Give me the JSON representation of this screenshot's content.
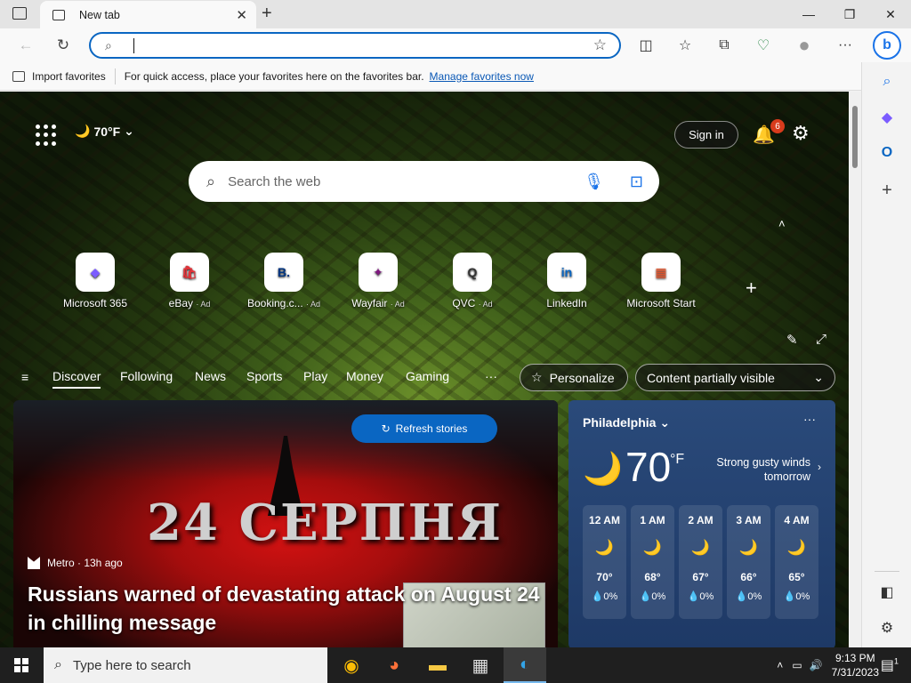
{
  "browser": {
    "tab_title": "New tab",
    "tab_close": "✕",
    "new_tab": "+",
    "window_min": "—",
    "window_max": "❐",
    "window_close": "✕"
  },
  "addressbar": {
    "value": "",
    "back": "←",
    "refresh": "↻",
    "favorite_star": "☆",
    "split_screen": "◫",
    "favorites": "☆",
    "collections": "⧉",
    "browser_essentials": "♡",
    "profile": "●",
    "more": "···",
    "bing": "b"
  },
  "favorites_bar": {
    "import_label": "Import favorites",
    "hint": "For quick access, place your favorites here on the favorites bar.",
    "manage_link": "Manage favorites now"
  },
  "sidebar": {
    "search": "⌕",
    "copilot": "◆",
    "outlook": "O",
    "add": "+",
    "layout": "◧",
    "settings": "⚙"
  },
  "page": {
    "weather_temp": "70°F",
    "moon": "🌙",
    "signin": "Sign in",
    "notification_count": "6",
    "search_placeholder": "Search the web",
    "search_icon": "⌕",
    "mic_icon": "🎙",
    "visual_search_icon": "⊡",
    "collapse_caret": "˄",
    "add_tile": "+",
    "tiles": [
      {
        "label": "Microsoft 365",
        "ad": "",
        "glyph": "◆",
        "color": "#7b5cff"
      },
      {
        "label": "eBay",
        "ad": "· Ad",
        "glyph": "🛍",
        "color": "#e53238"
      },
      {
        "label": "Booking.c...",
        "ad": "· Ad",
        "glyph": "B.",
        "color": "#003580"
      },
      {
        "label": "Wayfair",
        "ad": "· Ad",
        "glyph": "✦",
        "color": "#7f187f"
      },
      {
        "label": "QVC",
        "ad": "· Ad",
        "glyph": "Q",
        "color": "#333333"
      },
      {
        "label": "LinkedIn",
        "ad": "",
        "glyph": "in",
        "color": "#0a66c2"
      },
      {
        "label": "Microsoft Start",
        "ad": "",
        "glyph": "▦",
        "color": "#f25022"
      }
    ],
    "edit_icon": "✎",
    "expand_icon": "⤢"
  },
  "feed_nav": {
    "menu_icon": "≡",
    "items": [
      "Discover",
      "Following",
      "News",
      "Sports",
      "Play",
      "Money",
      "Gaming"
    ],
    "more": "···",
    "personalize": "Personalize",
    "content_visibility": "Content partially visible"
  },
  "story": {
    "refresh_label": "Refresh stories",
    "image_text": "24 СЕРПНЯ",
    "source": "Metro · 13h ago",
    "headline": "Russians warned of devastating attack on August 24 in chilling message"
  },
  "weather": {
    "city": "Philadelphia",
    "temp": "70",
    "unit": "°F",
    "wind": "Strong gusty winds tomorrow",
    "more": "···",
    "hours": [
      {
        "time": "12 AM",
        "temp": "70°",
        "precip": "💧0%"
      },
      {
        "time": "1 AM",
        "temp": "68°",
        "precip": "💧0%"
      },
      {
        "time": "2 AM",
        "temp": "67°",
        "precip": "💧0%"
      },
      {
        "time": "3 AM",
        "temp": "66°",
        "precip": "💧0%"
      },
      {
        "time": "4 AM",
        "temp": "65°",
        "precip": "💧0%"
      }
    ]
  },
  "taskbar": {
    "search_placeholder": "Type here to search",
    "apps": [
      "chrome",
      "firefox",
      "file-explorer",
      "store",
      "edge"
    ],
    "time": "9:13 PM",
    "date": "7/31/2023",
    "notification_count": "1"
  },
  "colors": {
    "accent": "#0a66c2",
    "weather_card": "#2a4a7a"
  }
}
